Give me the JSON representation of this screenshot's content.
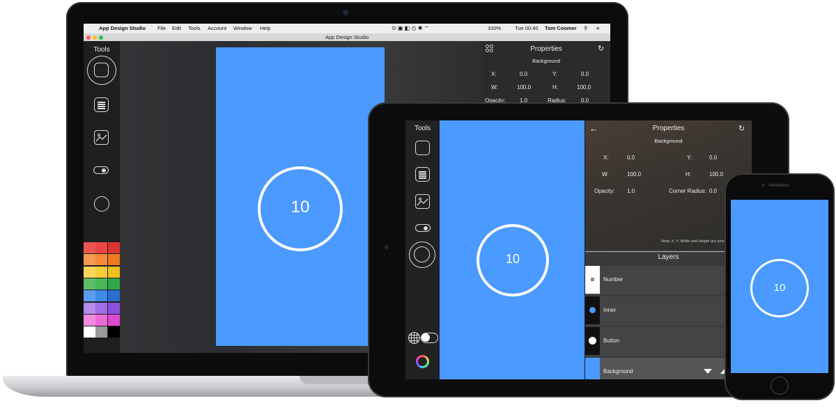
{
  "laptop": {
    "menubar": {
      "apple_icon": "apple-logo",
      "app_name": "App Design Studio",
      "menus": [
        "File",
        "Edit",
        "Tools",
        "Account",
        "Window",
        "Help"
      ],
      "battery": "100%",
      "clock": "Tue 00:40",
      "user": "Tom Coomer"
    },
    "window_title": "App Design Studio",
    "tools_title": "Tools",
    "canvas_value": "10",
    "properties": {
      "title": "Properties",
      "subtitle": "Background",
      "x_label": "X:",
      "x_value": "0.0",
      "y_label": "Y:",
      "y_value": "0.0",
      "w_label": "W:",
      "w_value": "100.0",
      "h_label": "H:",
      "h_value": "100.0",
      "opacity_label": "Opacity:",
      "opacity_value": "1.0",
      "radius_label": "Radius:",
      "radius_value": "0.0"
    },
    "swatches": [
      [
        "#e8564f",
        "#ee4444",
        "#dd3333"
      ],
      [
        "#f59a4f",
        "#f58a3a",
        "#ef7a20"
      ],
      [
        "#f9d65a",
        "#f6cc3a",
        "#f2c01e"
      ],
      [
        "#5dbd6a",
        "#4ab85a",
        "#2ea84a"
      ],
      [
        "#5a9cf0",
        "#3e8ae8",
        "#2a70d0"
      ],
      [
        "#b58ae8",
        "#a06ee6",
        "#8c50e0"
      ],
      [
        "#f08ae0",
        "#ec6ad8",
        "#e04ad0"
      ],
      [
        "#ffffff",
        "#9a9a9a",
        "#000000"
      ]
    ]
  },
  "tablet": {
    "tools_title": "Tools",
    "canvas_value": "10",
    "properties": {
      "title": "Properties",
      "subtitle": "Background",
      "x_label": "X:",
      "x_value": "0.0",
      "y_label": "Y:",
      "y_value": "0.0",
      "w_label": "W:",
      "w_value": "100.0",
      "h_label": "H:",
      "h_value": "100.0",
      "opacity_label": "Opacity:",
      "opacity_value": "1.0",
      "radius_label": "Corner Radius:",
      "radius_value": "0.0",
      "help": "Help: X, Y, Width and Height are percentage values."
    },
    "layers": {
      "title": "Layers",
      "items": [
        "Number",
        "Inner",
        "Button",
        "Background"
      ]
    }
  },
  "phone": {
    "canvas_value": "10"
  },
  "colors": {
    "accent_blue": "#4a9aff",
    "panel_dark": "#2b2b2d"
  }
}
